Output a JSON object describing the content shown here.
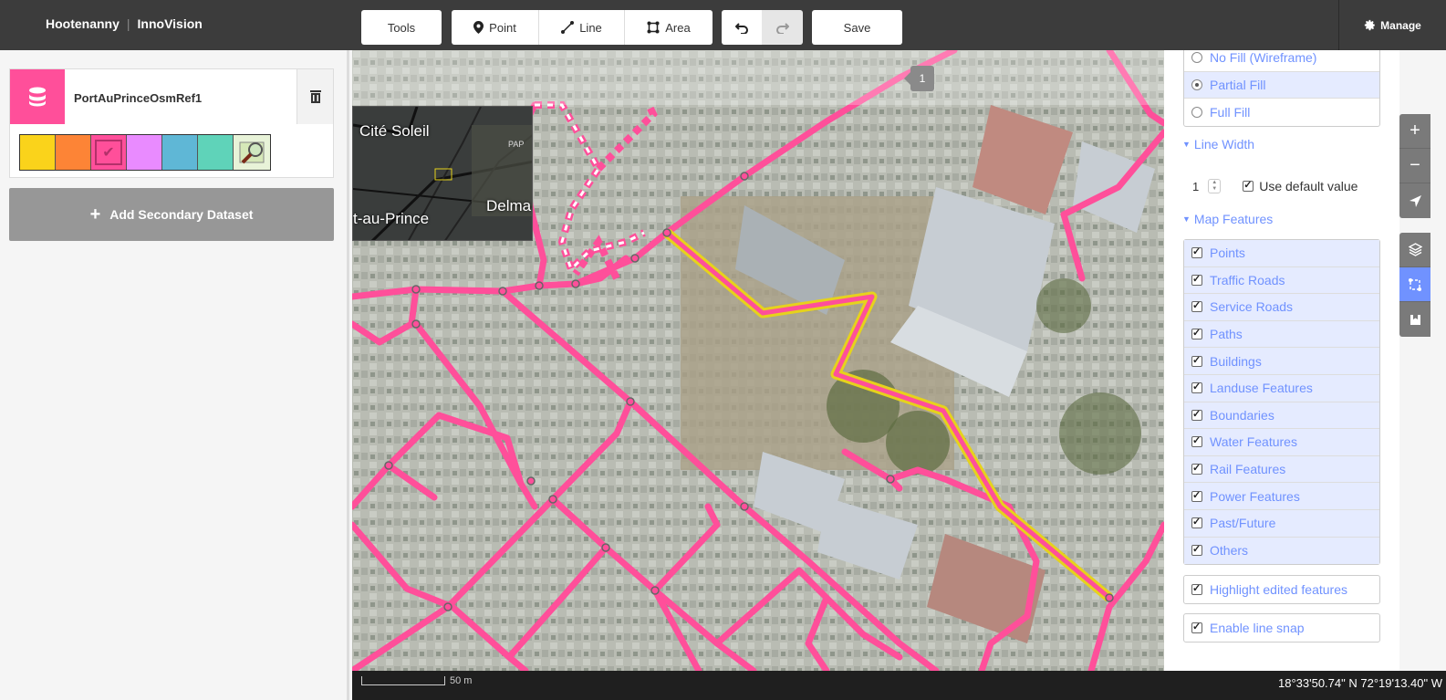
{
  "app": {
    "brand": "Hootenanny",
    "product": "InnoVision",
    "manage_label": "Manage"
  },
  "sidebar": {
    "dataset_name": "PortAuPrinceOsmRef1",
    "palette": [
      "#fad31b",
      "#fd8436",
      "#ff4f9a",
      "#e98bff",
      "#5fb7d6",
      "#5fd3b9"
    ],
    "selected_color_index": 2,
    "add_secondary_label": "Add Secondary Dataset"
  },
  "toolbar": {
    "tools_label": "Tools",
    "point_label": "Point",
    "line_label": "Line",
    "area_label": "Area",
    "save_label": "Save",
    "edit_count": "1"
  },
  "minimap": {
    "labels": [
      "Cité Soleil",
      "Delma",
      "t-au-Prince"
    ],
    "small_label": "PAP"
  },
  "footer": {
    "scale_label": "50 m",
    "coordinates": "18°33'50.74\" N 72°19'13.40\" W"
  },
  "panel": {
    "fill_options": [
      {
        "label": "No Fill (Wireframe)",
        "selected": false
      },
      {
        "label": "Partial Fill",
        "selected": true
      },
      {
        "label": "Full Fill",
        "selected": false
      }
    ],
    "line_width_title": "Line Width",
    "line_width_value": "1",
    "use_default_label": "Use default value",
    "map_features_title": "Map Features",
    "features": [
      "Points",
      "Traffic Roads",
      "Service Roads",
      "Paths",
      "Buildings",
      "Landuse Features",
      "Boundaries",
      "Water Features",
      "Rail Features",
      "Power Features",
      "Past/Future",
      "Others"
    ],
    "highlight_label": "Highlight edited features",
    "snap_label": "Enable line snap"
  },
  "colors": {
    "road": "#ff4f9a",
    "highlight": "#e6d21c",
    "accent": "#7092ff"
  }
}
